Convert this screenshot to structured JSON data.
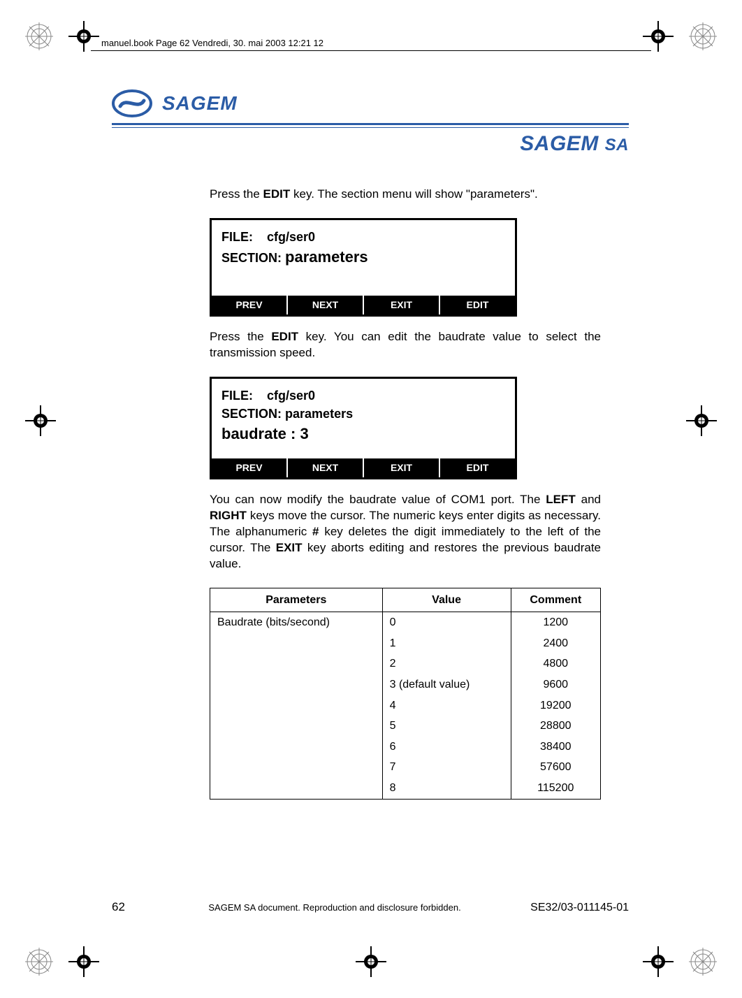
{
  "header_note": "manuel.book  Page 62  Vendredi, 30. mai 2003  12:21 12",
  "logo_text": "SAGEM",
  "brand_line": "SAGEM",
  "brand_suffix": "SA",
  "para1_pre": "Press the ",
  "para1_bold": "EDIT",
  "para1_post": " key. The section menu will show \"parameters\".",
  "lcd1": {
    "line1_label": "FILE:",
    "line1_value": "cfg/ser0",
    "line2_label": "SECTION:",
    "line2_value": "parameters",
    "buttons": [
      "PREV",
      "NEXT",
      "EXIT",
      "EDIT"
    ]
  },
  "para2_pre": "Press the ",
  "para2_bold": "EDIT",
  "para2_post": " key. You can edit the baudrate value to select the transmission speed.",
  "lcd2": {
    "line1_label": "FILE:",
    "line1_value": "cfg/ser0",
    "line2_label": "SECTION:",
    "line2_value": "parameters",
    "line3": "baudrate : 3",
    "buttons": [
      "PREV",
      "NEXT",
      "EXIT",
      "EDIT"
    ]
  },
  "para3_a": "You can now modify the baudrate value of COM1 port. The ",
  "para3_b1": "LEFT",
  "para3_b": " and ",
  "para3_b2": "RIGHT",
  "para3_c": " keys move the cursor. The numeric keys enter digits as necessary. The alphanumeric ",
  "para3_b3": "#",
  "para3_d": " key deletes the digit immediately to the left of the cursor. The ",
  "para3_b4": "EXIT",
  "para3_e": " key aborts editing and restores the previous baudrate value.",
  "table": {
    "headers": [
      "Parameters",
      "Value",
      "Comment"
    ],
    "param_label": "Baudrate (bits/second)",
    "rows": [
      {
        "value": "0",
        "comment": "1200"
      },
      {
        "value": "1",
        "comment": "2400"
      },
      {
        "value": "2",
        "comment": "4800"
      },
      {
        "value": "3 (default value)",
        "comment": "9600"
      },
      {
        "value": "4",
        "comment": "19200"
      },
      {
        "value": "5",
        "comment": "28800"
      },
      {
        "value": "6",
        "comment": "38400"
      },
      {
        "value": "7",
        "comment": "57600"
      },
      {
        "value": "8",
        "comment": "115200"
      }
    ]
  },
  "footer": {
    "page": "62",
    "mid": "SAGEM SA document. Reproduction and disclosure forbidden.",
    "doc": "SE32/03-011145-01"
  }
}
